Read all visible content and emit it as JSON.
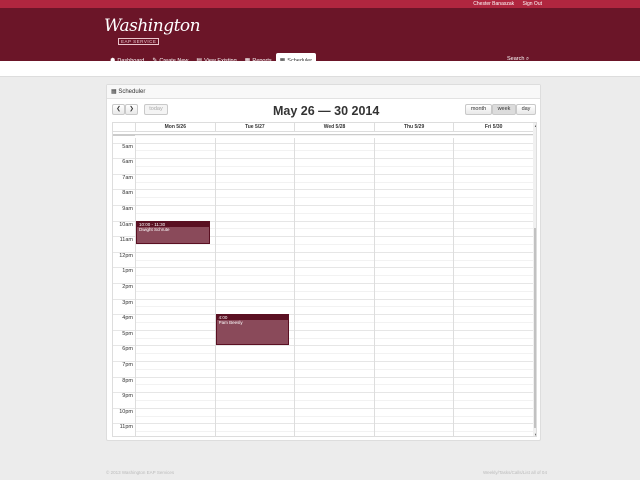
{
  "topbar": {
    "user_name": "Chester Banaszak",
    "sign_out": "Sign Out"
  },
  "logo": {
    "script": "Washington",
    "sub": "EAP SERVICE"
  },
  "nav": [
    {
      "label": "Dashboard",
      "icon": "dashboard-icon",
      "glyph": "☗"
    },
    {
      "label": "Create New",
      "icon": "pencil-icon",
      "glyph": "✎"
    },
    {
      "label": "View Existing",
      "icon": "file-icon",
      "glyph": "▤"
    },
    {
      "label": "Reports",
      "icon": "chart-icon",
      "glyph": "▦"
    },
    {
      "label": "Scheduler",
      "icon": "calendar-icon",
      "glyph": "▦",
      "active": true
    }
  ],
  "search": {
    "label": "Search"
  },
  "panel": {
    "title": "Scheduler"
  },
  "calendar": {
    "title": "May 26 — 30 2014",
    "today_label": "today",
    "views": [
      "month",
      "week",
      "day"
    ],
    "active_view": "week",
    "days": [
      "Mon 5/26",
      "Tue 5/27",
      "Wed 5/28",
      "Thu 5/29",
      "Fri 5/30"
    ],
    "hours": [
      "5am",
      "6am",
      "7am",
      "8am",
      "9am",
      "10am",
      "11am",
      "12pm",
      "1pm",
      "2pm",
      "3pm",
      "4pm",
      "5pm",
      "6pm",
      "7pm",
      "8pm",
      "9pm",
      "10pm",
      "11pm"
    ],
    "events": [
      {
        "day": 0,
        "time": "10:00 - 11:30",
        "title": "Dwight Schrute",
        "start": 10.0,
        "end": 11.5
      },
      {
        "day": 1,
        "time": "4:00",
        "title": "Pam Beesly",
        "start": 16.0,
        "end": 18.0
      }
    ]
  },
  "footer": {
    "left": "© 2013 Washington EAP Services",
    "right": "Weekly/Tasks/Calls/List all of 04"
  }
}
